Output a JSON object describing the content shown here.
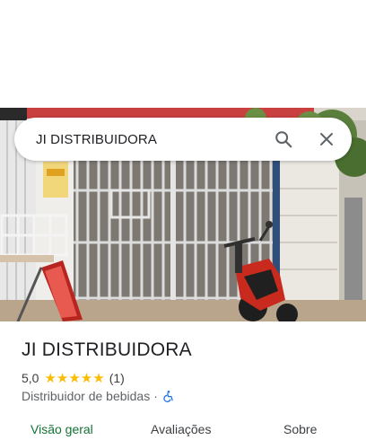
{
  "search": {
    "value": "JI DISTRIBUIDORA"
  },
  "icons": {
    "search": "search-icon",
    "close": "close-icon",
    "accessibility": "wheelchair-icon"
  },
  "place": {
    "name": "JI DISTRIBUIDORA",
    "rating": "5,0",
    "stars": "★★★★★",
    "review_count": "(1)",
    "category": "Distribuidor de bebidas",
    "separator": "·"
  },
  "tabs": [
    {
      "label": "Visão geral"
    },
    {
      "label": "Avaliações"
    },
    {
      "label": "Sobre"
    }
  ],
  "colors": {
    "star": "#fbbc04",
    "active_tab": "#137333",
    "accessibility": "#1a73e8"
  }
}
